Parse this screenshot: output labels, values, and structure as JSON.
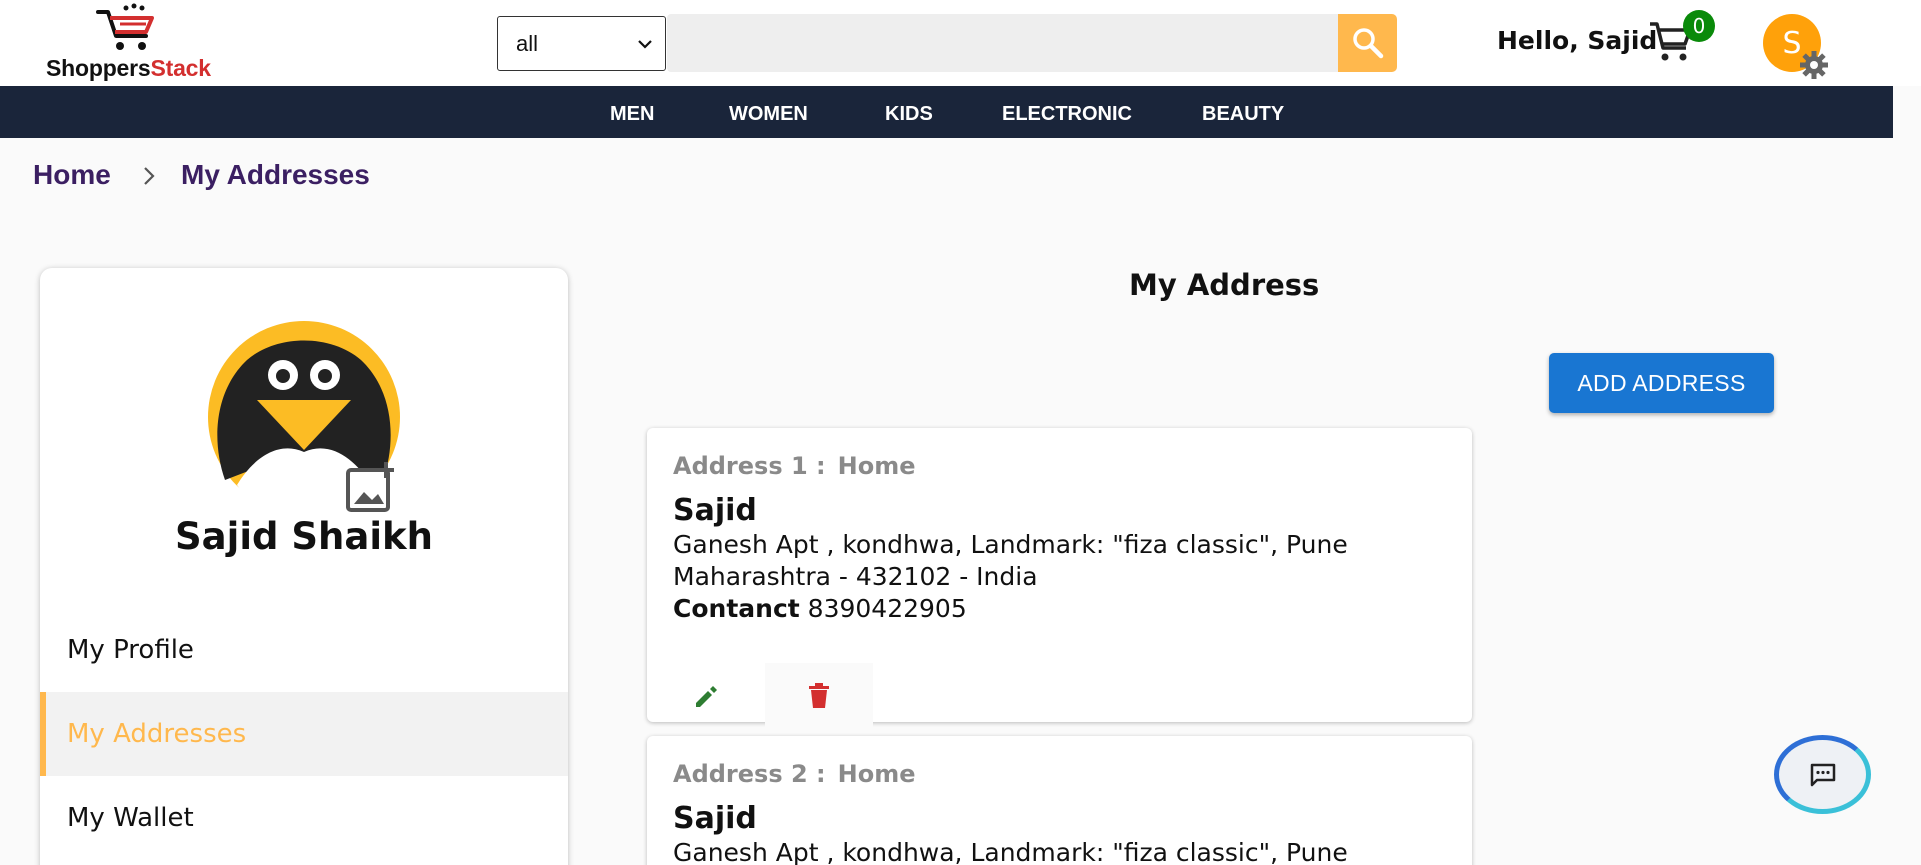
{
  "header": {
    "logo": {
      "part1": "Shoppers",
      "part2": "Stack"
    },
    "category_select": {
      "value": "all"
    },
    "search": {
      "placeholder": ""
    },
    "greeting": "Hello, Sajid",
    "cart_count": "0",
    "avatar_letter": "S"
  },
  "nav": {
    "items": [
      {
        "label": "MEN"
      },
      {
        "label": "WOMEN"
      },
      {
        "label": "KIDS"
      },
      {
        "label": "ELECTRONIC"
      },
      {
        "label": "BEAUTY"
      }
    ]
  },
  "breadcrumb": {
    "home": "Home",
    "current": "My Addresses"
  },
  "sidebar": {
    "name": "Sajid Shaikh",
    "items": [
      {
        "label": "My Profile"
      },
      {
        "label": "My Addresses"
      },
      {
        "label": "My Wallet"
      }
    ]
  },
  "main": {
    "title": "My Address",
    "add_button": "ADD ADDRESS",
    "addresses": [
      {
        "label": "Address 1 :",
        "type": "Home",
        "name": "Sajid",
        "line1": "Ganesh Apt , kondhwa, Landmark: \"fiza classic\", Pune",
        "line2": "Maharashtra - 432102 - India",
        "contact_label": "Contanct",
        "contact": "8390422905"
      },
      {
        "label": "Address 2 :",
        "type": "Home",
        "name": "Sajid",
        "line1": "Ganesh Apt , kondhwa, Landmark: \"fiza classic\", Pune"
      }
    ]
  },
  "colors": {
    "nav_bg": "#1a253a",
    "accent": "#ffb84d",
    "primary": "#1976d2",
    "cart_badge": "#0a8a0a",
    "avatar": "#ffa10a",
    "edit": "#2e7d32",
    "delete": "#d32f2f",
    "breadcrumb": "#3b1f62"
  },
  "icons": [
    "cart-logo-icon",
    "chevron-down-icon",
    "search-icon",
    "cart-icon",
    "gear-icon",
    "penguin-avatar-icon",
    "add-photo-icon",
    "chevron-right-icon",
    "edit-icon",
    "delete-icon",
    "chat-icon"
  ]
}
